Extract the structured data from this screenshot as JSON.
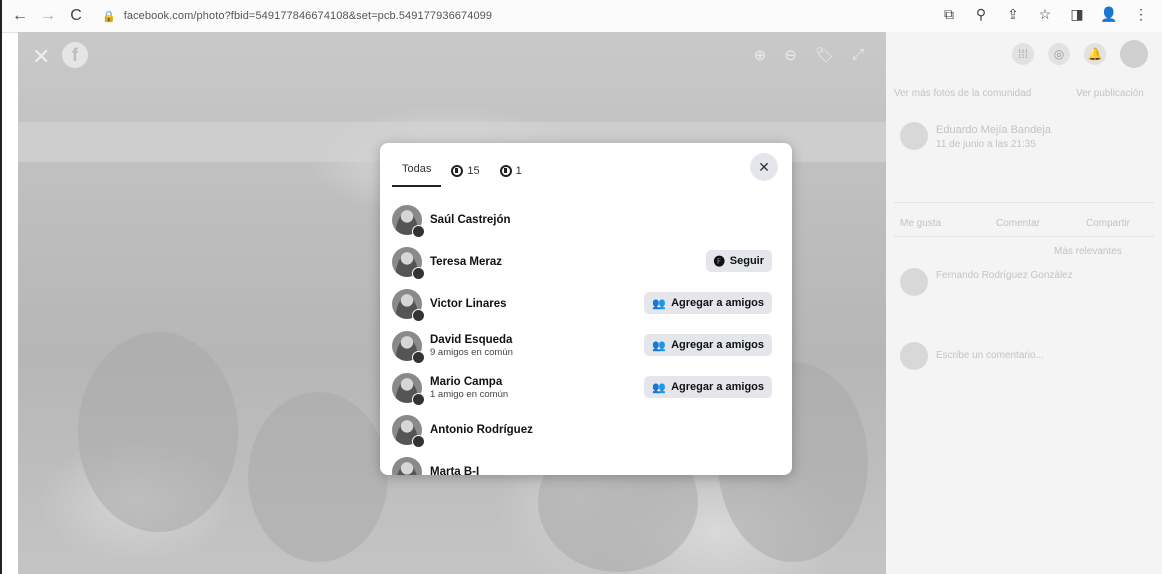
{
  "browser": {
    "back_icon": "←",
    "forward_icon": "→",
    "reload_icon": "C",
    "lock_icon": "🔒",
    "url": "facebook.com/photo?fbid=549177846674108&set=pcb.549177936674099",
    "ext_icons": [
      "⧉",
      "⚲",
      "⇪",
      "☆",
      "◨",
      "👤",
      "⋮"
    ]
  },
  "viewer": {
    "close_icon": "✕",
    "logo_letter": "f",
    "tools": [
      "⊕",
      "⊖",
      "🏷",
      "⤢"
    ]
  },
  "modal": {
    "tabs": [
      {
        "label": "Todas",
        "active": true
      },
      {
        "label": "15",
        "icon": "like-reaction-icon"
      },
      {
        "label": "1",
        "icon": "like-reaction-icon"
      }
    ],
    "close_icon": "✕",
    "people": [
      {
        "name": "Saúl Castrejón",
        "subtitle": "",
        "button": ""
      },
      {
        "name": "Teresa Meraz",
        "subtitle": "",
        "button": "Seguir",
        "button_icon": "🅕"
      },
      {
        "name": "Victor Linares",
        "subtitle": "",
        "button": "Agregar a amigos",
        "button_icon": "👥"
      },
      {
        "name": "David Esqueda",
        "subtitle": "9 amigos en común",
        "button": "Agregar a amigos",
        "button_icon": "👥"
      },
      {
        "name": "Mario Campa",
        "subtitle": "1 amigo en común",
        "button": "Agregar a amigos",
        "button_icon": "👥"
      },
      {
        "name": "Antonio Rodríguez",
        "subtitle": "",
        "button": ""
      },
      {
        "name": "Marta B-I",
        "subtitle": "",
        "button": ""
      }
    ]
  },
  "right_panel": {
    "top_icons": [
      "⁞⁞⁞",
      "◎",
      "🔔"
    ],
    "faint_lines": [
      "Ver más fotos de la comunidad",
      "Ver publicación",
      "Eduardo Mejía Bandeja",
      "11 de junio a las 21:35",
      "Me gusta",
      "Comentar",
      "Compartir",
      "Más relevantes",
      "Fernando Rodríguez González",
      "Escribe un comentario..."
    ]
  }
}
